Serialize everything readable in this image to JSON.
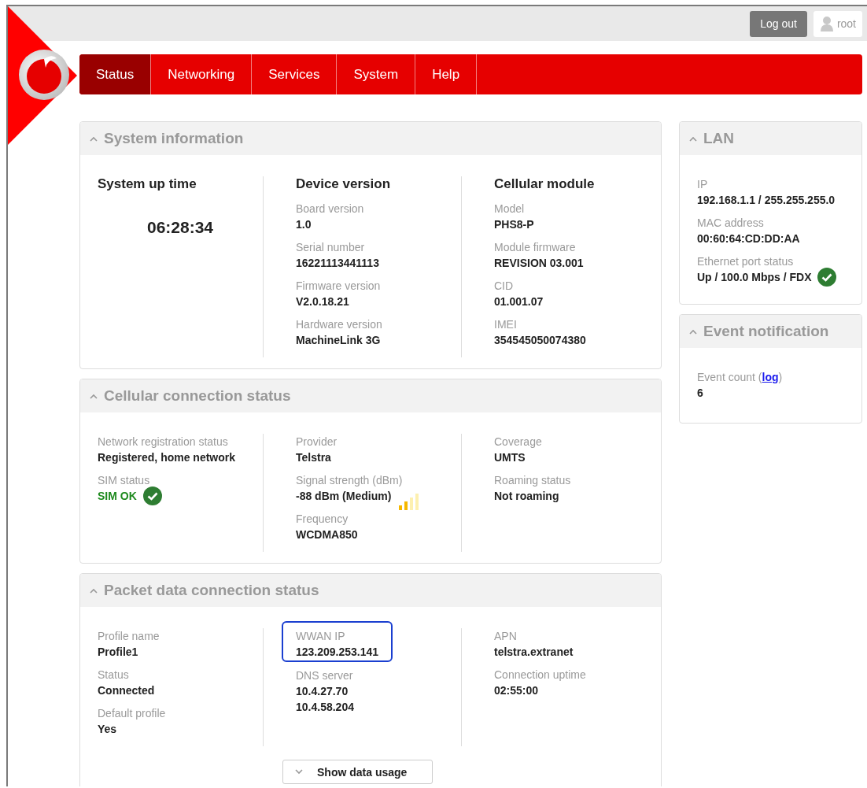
{
  "top_bar": {
    "logout_button": "Log out",
    "user": "root"
  },
  "nav": [
    {
      "label": "Status",
      "selected": true
    },
    {
      "label": "Networking",
      "selected": false
    },
    {
      "label": "Services",
      "selected": false
    },
    {
      "label": "System",
      "selected": false
    },
    {
      "label": "Help",
      "selected": false
    }
  ],
  "main_panels": [
    {
      "title": "System information",
      "expanded": true,
      "columns": [
        {
          "heading": "System up time",
          "big_value": "06:28:34"
        },
        {
          "heading": "Device version",
          "fields": [
            {
              "label": "Board version",
              "values": [
                "1.0"
              ],
              "kind": "plain",
              "highlighted": false
            },
            {
              "label": "Serial number",
              "values": [
                "16221113441113"
              ],
              "kind": "plain",
              "highlighted": false
            },
            {
              "label": "Firmware version",
              "values": [
                "V2.0.18.21"
              ],
              "kind": "plain",
              "highlighted": false
            },
            {
              "label": "Hardware version",
              "values": [
                "MachineLink 3G"
              ],
              "kind": "plain",
              "highlighted": false
            }
          ]
        },
        {
          "heading": "Cellular module",
          "fields": [
            {
              "label": "Model",
              "values": [
                "PHS8-P"
              ],
              "kind": "plain",
              "highlighted": false
            },
            {
              "label": "Module firmware",
              "values": [
                "REVISION 03.001"
              ],
              "kind": "plain",
              "highlighted": false
            },
            {
              "label": "CID",
              "values": [
                "01.001.07"
              ],
              "kind": "plain",
              "highlighted": false
            },
            {
              "label": "IMEI",
              "values": [
                "354545050074380"
              ],
              "kind": "plain",
              "highlighted": false
            }
          ]
        }
      ]
    },
    {
      "title": "Cellular connection status",
      "expanded": true,
      "columns": [
        {
          "fields": [
            {
              "label": "Network registration status",
              "values": [
                "Registered, home network"
              ],
              "kind": "plain",
              "highlighted": false
            },
            {
              "label": "SIM status",
              "values": [
                "SIM OK"
              ],
              "kind": "ok-green",
              "highlighted": false
            }
          ]
        },
        {
          "fields": [
            {
              "label": "Provider",
              "values": [
                "Telstra"
              ],
              "kind": "plain",
              "highlighted": false
            },
            {
              "label": "Signal strength (dBm)",
              "values": [
                "-88 dBm (Medium)"
              ],
              "kind": "signal",
              "highlighted": false
            },
            {
              "label": "Frequency",
              "values": [
                "WCDMA850"
              ],
              "kind": "plain",
              "highlighted": false
            }
          ]
        },
        {
          "fields": [
            {
              "label": "Coverage",
              "values": [
                "UMTS"
              ],
              "kind": "plain",
              "highlighted": false
            },
            {
              "label": "Roaming status",
              "values": [
                "Not roaming"
              ],
              "kind": "plain",
              "highlighted": false
            }
          ]
        }
      ]
    },
    {
      "title": "Packet data connection status",
      "expanded": true,
      "columns": [
        {
          "fields": [
            {
              "label": "Profile name",
              "values": [
                "Profile1"
              ],
              "kind": "plain",
              "highlighted": false
            },
            {
              "label": "Status",
              "values": [
                "Connected"
              ],
              "kind": "plain",
              "highlighted": false
            },
            {
              "label": "Default profile",
              "values": [
                "Yes"
              ],
              "kind": "plain",
              "highlighted": false
            }
          ]
        },
        {
          "fields": [
            {
              "label": "WWAN IP",
              "values": [
                "123.209.253.141"
              ],
              "kind": "plain",
              "highlighted": true
            },
            {
              "label": "DNS server",
              "values": [
                "10.4.27.70",
                "10.4.58.204"
              ],
              "kind": "plain",
              "highlighted": false
            }
          ]
        },
        {
          "fields": [
            {
              "label": "APN",
              "values": [
                "telstra.extranet"
              ],
              "kind": "plain",
              "highlighted": false
            },
            {
              "label": "Connection uptime",
              "values": [
                "02:55:00"
              ],
              "kind": "plain",
              "highlighted": false
            }
          ]
        }
      ],
      "button": "Show data usage"
    }
  ],
  "side_panels": [
    {
      "title": "LAN",
      "expanded": true,
      "fields": [
        {
          "label": "IP",
          "values": [
            "192.168.1.1 / 255.255.255.0"
          ],
          "kind": "plain",
          "highlighted": false
        },
        {
          "label": "MAC address",
          "values": [
            "00:60:64:CD:DD:AA"
          ],
          "kind": "plain",
          "highlighted": false
        },
        {
          "label": "Ethernet port status",
          "values": [
            "Up / 100.0 Mbps / FDX"
          ],
          "kind": "ok",
          "highlighted": false
        }
      ]
    },
    {
      "title": "Event notification",
      "expanded": true,
      "fields": [
        {
          "label": "Event count (",
          "link": "log",
          "label_end": ")",
          "values": [
            "6"
          ],
          "kind": "plain",
          "highlighted": false
        }
      ]
    }
  ]
}
